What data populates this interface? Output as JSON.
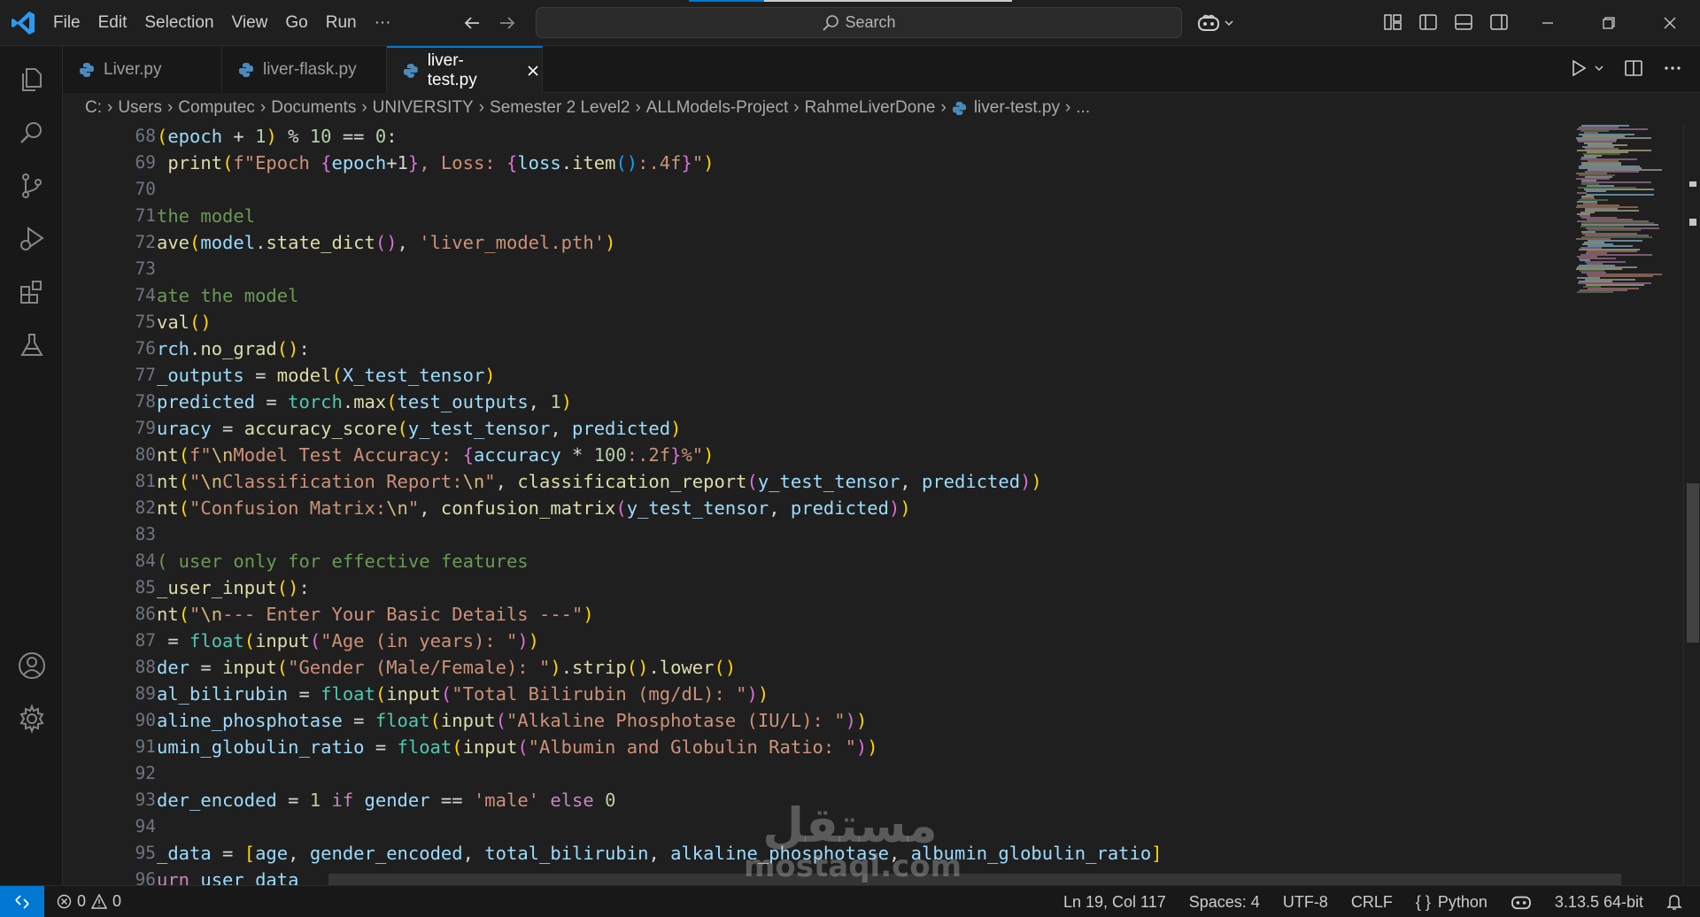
{
  "menu": [
    "File",
    "Edit",
    "Selection",
    "View",
    "Go",
    "Run",
    "···"
  ],
  "search": {
    "label": "Search"
  },
  "tabs": [
    {
      "label": "Liver.py",
      "active": false
    },
    {
      "label": "liver-flask.py",
      "active": false
    },
    {
      "label": "liver-test.py",
      "active": true
    }
  ],
  "breadcrumb": [
    "C:",
    "Users",
    "Computec",
    "Documents",
    "UNIVERSITY",
    "Semester 2 Level2",
    "ALLModels-Project",
    "RahmeLiverDone",
    "liver-test.py",
    "..."
  ],
  "editor": {
    "line_numbers": [
      "68",
      "69",
      "70",
      "71",
      "72",
      "73",
      "74",
      "75",
      "76",
      "77",
      "78",
      "79",
      "80",
      "81",
      "82",
      "83",
      "84",
      "85",
      "86",
      "87",
      "88",
      "89",
      "90",
      "91",
      "92",
      "93",
      "94",
      "95",
      "96"
    ]
  },
  "watermark": {
    "arabic": "مستقل",
    "latin": "mostaql.com"
  },
  "status": {
    "errors": "0",
    "warnings": "0",
    "position": "Ln 19, Col 117",
    "spaces": "Spaces: 4",
    "encoding": "UTF-8",
    "eol": "CRLF",
    "language": "Python",
    "interpreter": "3.13.5 64-bit"
  },
  "colors": {
    "accent": "#0078d4",
    "keyword": "#c586c0",
    "function": "#dcdcaa",
    "variable": "#9cdcfe",
    "string": "#ce9178",
    "number": "#b5cea8",
    "comment": "#6a9955"
  }
}
